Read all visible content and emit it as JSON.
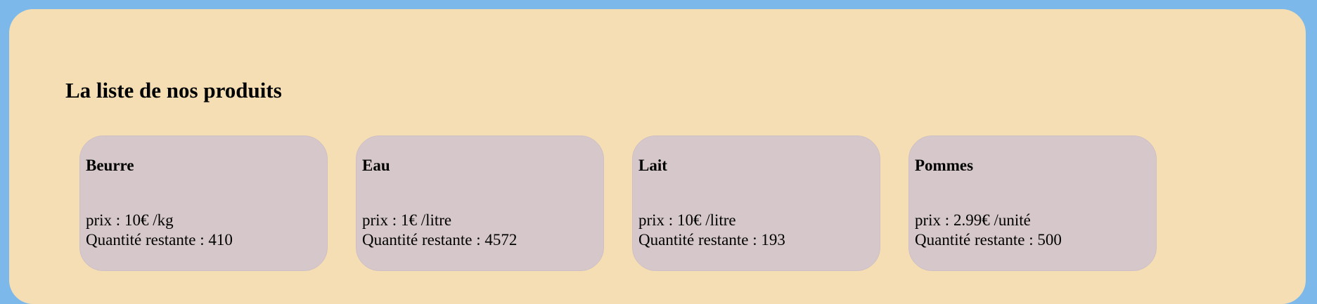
{
  "page": {
    "title": "La liste de nos produits"
  },
  "products": [
    {
      "name": "Beurre",
      "price": "prix : 10€ /kg",
      "stock": "Quantité restante : 410"
    },
    {
      "name": "Eau",
      "price": "prix : 1€ /litre",
      "stock": "Quantité restante : 4572"
    },
    {
      "name": "Lait",
      "price": "prix : 10€ /litre",
      "stock": "Quantité restante : 193"
    },
    {
      "name": "Pommes",
      "price": "prix : 2.99€ /unité",
      "stock": "Quantité restante : 500"
    }
  ],
  "colors": {
    "background": "#7cb8ea",
    "panel": "#f5deb3",
    "card": "#d6c8ca"
  }
}
